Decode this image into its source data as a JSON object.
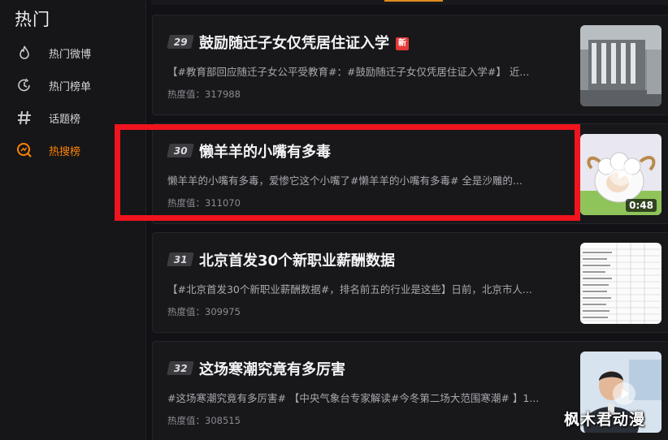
{
  "sidebar": {
    "title": "热门",
    "items": [
      {
        "label": "热门微博",
        "icon": "flame-icon",
        "active": false
      },
      {
        "label": "热门榜单",
        "icon": "clock-icon",
        "active": false
      },
      {
        "label": "话题榜",
        "icon": "hashtag-icon",
        "active": false
      },
      {
        "label": "热搜榜",
        "icon": "search-trend-icon",
        "active": true
      }
    ]
  },
  "colors": {
    "accent": "#ff8200",
    "highlight": "#f0141e",
    "badge": "#e53935"
  },
  "cards": [
    {
      "rank": "29",
      "title": "鼓励随迁子女仅凭居住证入学",
      "badge": "新",
      "summary": "【#教育部回应随迁子女公平受教育#：#鼓励随迁子女仅凭居住证入学#】 近...",
      "heat": "热度值：317988",
      "thumb": "building-photo"
    },
    {
      "rank": "30",
      "title": "懒羊羊的小嘴有多毒",
      "summary": "懒羊羊的小嘴有多毒，爱惨它这个小嘴了#懒羊羊的小嘴有多毒#  全是沙雕的...",
      "heat": "热度值：311070",
      "thumb": "cartoon-sheep-video",
      "duration": "0:48"
    },
    {
      "rank": "31",
      "title": "北京首发30个新职业薪酬数据",
      "summary": "【#北京首发30个新职业薪酬数据#，排名前五的行业是这些】日前，北京市人...",
      "heat": "热度值：309975",
      "thumb": "salary-table-image"
    },
    {
      "rank": "32",
      "title": "这场寒潮究竟有多厉害",
      "summary": "#这场寒潮究竟有多厉害# 【中央气象台专家解读#今冬第二场大范围寒潮# 】1...",
      "heat": "热度值：308515",
      "thumb": "news-anchor-video"
    }
  ],
  "watermark": "枫木君动漫"
}
